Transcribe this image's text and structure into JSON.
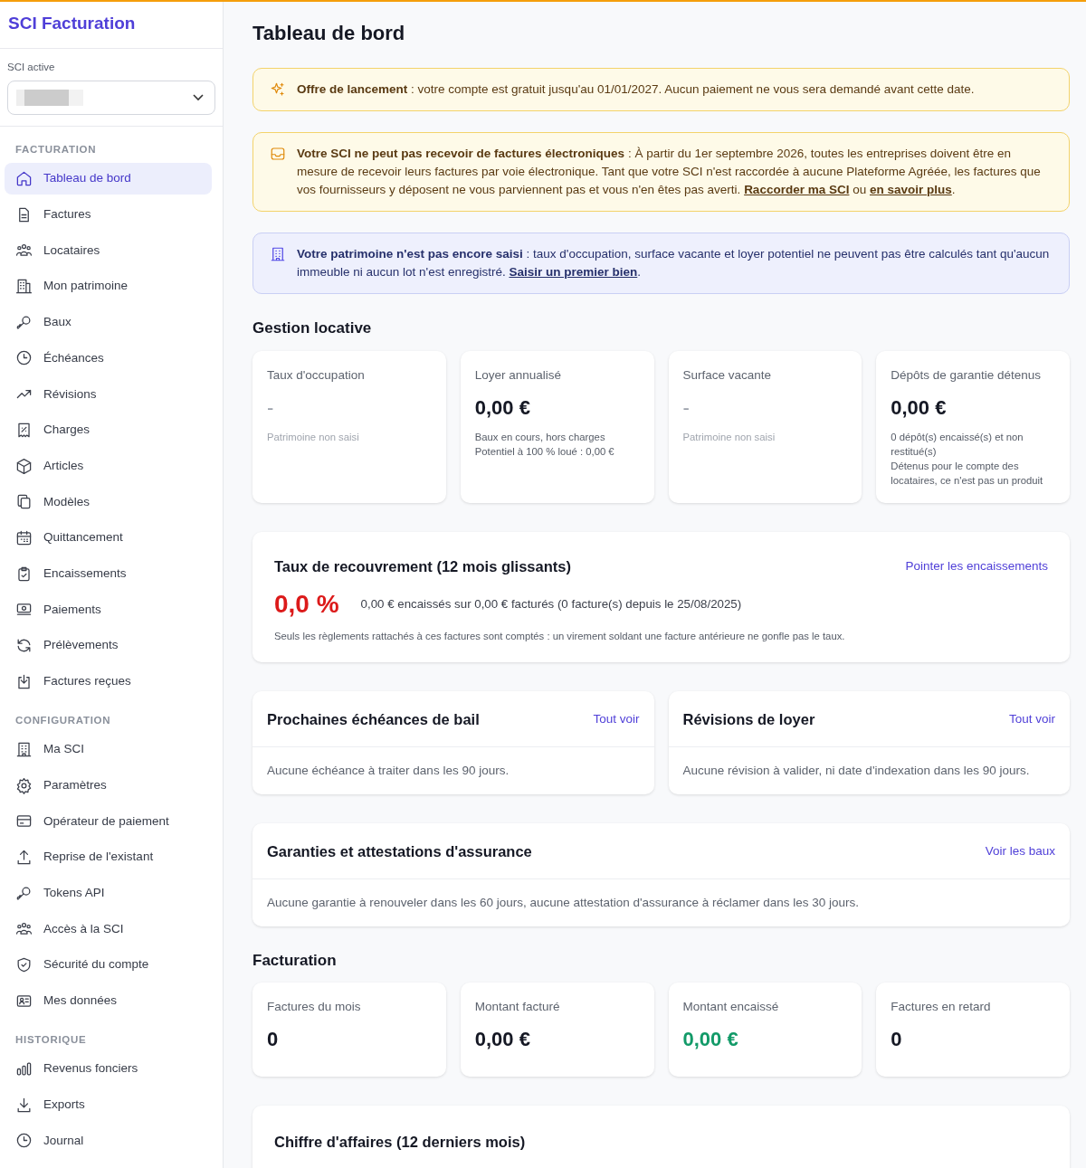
{
  "app": {
    "title": "SCI Facturation"
  },
  "sci_selector": {
    "label": "SCI active"
  },
  "sidebar": {
    "sections": [
      {
        "title": "FACTURATION",
        "items": [
          {
            "label": "Tableau de bord",
            "selected": true
          },
          {
            "label": "Factures",
            "selected": false
          },
          {
            "label": "Locataires",
            "selected": false
          },
          {
            "label": "Mon patrimoine",
            "selected": false
          },
          {
            "label": "Baux",
            "selected": false
          },
          {
            "label": "Échéances",
            "selected": false
          },
          {
            "label": "Révisions",
            "selected": false
          },
          {
            "label": "Charges",
            "selected": false
          },
          {
            "label": "Articles",
            "selected": false
          },
          {
            "label": "Modèles",
            "selected": false
          },
          {
            "label": "Quittancement",
            "selected": false
          },
          {
            "label": "Encaissements",
            "selected": false
          },
          {
            "label": "Paiements",
            "selected": false
          },
          {
            "label": "Prélèvements",
            "selected": false
          },
          {
            "label": "Factures reçues",
            "selected": false
          }
        ]
      },
      {
        "title": "CONFIGURATION",
        "items": [
          {
            "label": "Ma SCI",
            "selected": false
          },
          {
            "label": "Paramètres",
            "selected": false
          },
          {
            "label": "Opérateur de paiement",
            "selected": false
          },
          {
            "label": "Reprise de l'existant",
            "selected": false
          },
          {
            "label": "Tokens API",
            "selected": false
          },
          {
            "label": "Accès à la SCI",
            "selected": false
          },
          {
            "label": "Sécurité du compte",
            "selected": false
          },
          {
            "label": "Mes données",
            "selected": false
          }
        ]
      },
      {
        "title": "HISTORIQUE",
        "items": [
          {
            "label": "Revenus fonciers",
            "selected": false
          },
          {
            "label": "Exports",
            "selected": false
          },
          {
            "label": "Journal",
            "selected": false
          }
        ]
      }
    ]
  },
  "page_title": "Tableau de bord",
  "alerts": [
    {
      "kind": "warning",
      "parts": [
        {
          "kind": "text",
          "text": "**Offre de lancement** : votre compte est gratuit jusqu'au 01/01/2027. Aucun paiement ne vous sera demandé avant cette date."
        }
      ]
    },
    {
      "kind": "warning",
      "parts": [
        {
          "kind": "text",
          "text": "**Votre SCI ne peut pas recevoir de factures électroniques** : À partir du 1er septembre 2026, toutes les entreprises doivent être en mesure de recevoir leurs factures par voie électronique. Tant que votre SCI n'est raccordée à aucune Plateforme Agréée, les factures que vos fournisseurs y déposent ne vous parviennent pas et vous n'en êtes pas averti. "
        },
        {
          "kind": "link",
          "text": "Raccorder ma SCI"
        },
        {
          "kind": "text",
          "text": " ou "
        },
        {
          "kind": "link",
          "text": "en savoir plus"
        },
        {
          "kind": "text",
          "text": "."
        }
      ]
    },
    {
      "kind": "info",
      "parts": [
        {
          "kind": "text",
          "text": "**Votre patrimoine n'est pas encore saisi** : taux d'occupation, surface vacante et loyer potentiel ne peuvent pas être calculés tant qu'aucun immeuble ni aucun lot n'est enregistré. "
        },
        {
          "kind": "link",
          "text": "Saisir un premier bien"
        },
        {
          "kind": "text",
          "text": "."
        }
      ]
    }
  ],
  "rental_section": {
    "title": "Gestion locative",
    "stats": [
      {
        "label": "Taux d'occupation",
        "value": "-",
        "kind": "muted",
        "notes": [
          "Patrimoine non saisi"
        ]
      },
      {
        "label": "Loyer annualisé",
        "value": "0,00 €",
        "kind": "default",
        "notes": [
          "Baux en cours, hors charges",
          "Potentiel à 100 % loué : 0,00 €"
        ]
      },
      {
        "label": "Surface vacante",
        "value": "-",
        "kind": "muted",
        "notes": [
          "Patrimoine non saisi"
        ]
      },
      {
        "label": "Dépôts de garantie détenus",
        "value": "0,00 €",
        "kind": "default",
        "notes": [
          "0 dépôt(s) encaissé(s) et non restitué(s)",
          "Détenus pour le compte des locataires, ce n'est pas un produit"
        ]
      }
    ]
  },
  "recovery": {
    "title": "Taux de recouvrement (12 mois glissants)",
    "link": "Pointer les encaissements",
    "rate": "0,0 %",
    "summary": "0,00 € encaissés sur 0,00 € facturés (0 facture(s) depuis le 25/08/2025)",
    "footnote": "Seuls les règlements rattachés à ces factures sont comptés : un virement soldant une facture antérieure ne gonfle pas le taux."
  },
  "panels": [
    {
      "title": "Prochaines échéances de bail",
      "link": "Tout voir",
      "empty": "Aucune échéance à traiter dans les 90 jours."
    },
    {
      "title": "Révisions de loyer",
      "link": "Tout voir",
      "empty": "Aucune révision à valider, ni date d'indexation dans les 90 jours."
    },
    {
      "title": "Garanties et attestations d'assurance",
      "link": "Voir les baux",
      "empty": "Aucune garantie à renouveler dans les 60 jours, aucune attestation d'assurance à réclamer dans les 30 jours."
    }
  ],
  "billing_section": {
    "title": "Facturation",
    "stats": [
      {
        "label": "Factures du mois",
        "value": "0",
        "kind": "default"
      },
      {
        "label": "Montant facturé",
        "value": "0,00 €",
        "kind": "default"
      },
      {
        "label": "Montant encaissé",
        "value": "0,00 €",
        "kind": "positive"
      },
      {
        "label": "Factures en retard",
        "value": "0",
        "kind": "default"
      }
    ]
  },
  "revenue_card": {
    "title": "Chiffre d'affaires (12 derniers mois)"
  }
}
